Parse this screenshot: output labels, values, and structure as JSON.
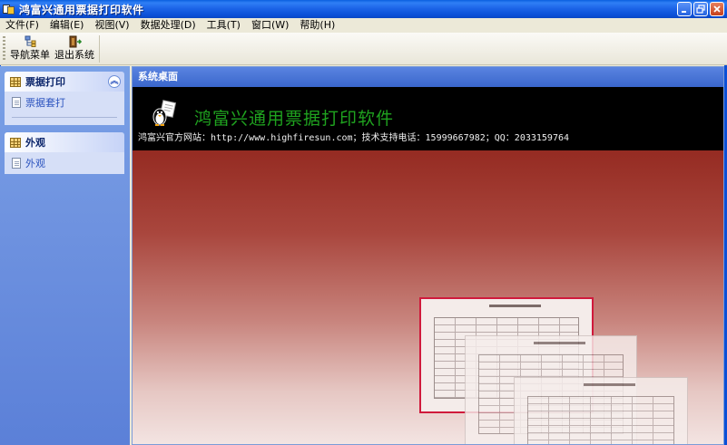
{
  "window": {
    "title": "鸿富兴通用票据打印软件",
    "controls": [
      "minimize-icon",
      "restore-icon",
      "close-icon"
    ]
  },
  "menubar": {
    "items": [
      {
        "label": "文件(F)"
      },
      {
        "label": "编辑(E)"
      },
      {
        "label": "视图(V)"
      },
      {
        "label": "数据处理(D)"
      },
      {
        "label": "工具(T)"
      },
      {
        "label": "窗口(W)"
      },
      {
        "label": "帮助(H)"
      }
    ]
  },
  "toolbar": {
    "nav_label": "导航菜单",
    "exit_label": "退出系统"
  },
  "sidebar": {
    "groups": [
      {
        "title": "票据打印",
        "items": [
          {
            "label": "票据套打"
          }
        ],
        "icon": "grid-icon"
      },
      {
        "title": "外观",
        "items": [
          {
            "label": "外观"
          }
        ],
        "icon": "grid-icon"
      }
    ]
  },
  "main": {
    "header": "系统桌面",
    "banner_title": "鸿富兴通用票据打印软件",
    "banner_info": "鸿富兴官方网站：http://www.highfiresun.com；技术支持电话：15999667982；QQ：2033159764"
  },
  "colors": {
    "titlebar": "#0b4fd6",
    "banner_title": "#1fa21f",
    "desktop_top": "#952b22",
    "selected_doc_border": "#d01a3c"
  }
}
